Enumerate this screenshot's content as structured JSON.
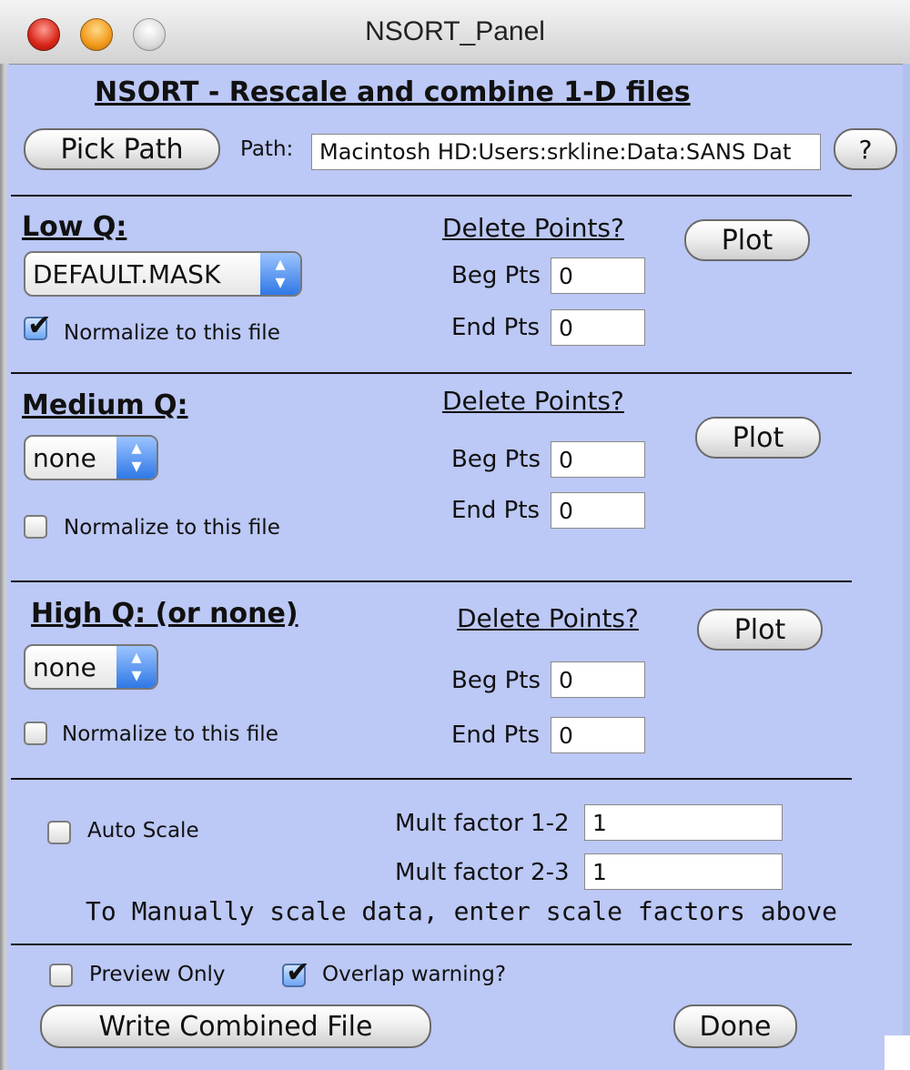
{
  "window": {
    "title": "NSORT_Panel"
  },
  "header": {
    "title": "NSORT - Rescale and combine 1-D files"
  },
  "path": {
    "button": "Pick Path",
    "label": "Path:",
    "value": "Macintosh HD:Users:srkline:Data:SANS Dat",
    "help": "?"
  },
  "low": {
    "heading": "Low Q:",
    "file": "DEFAULT.MASK",
    "normalize": "Normalize to this file",
    "normalize_checked": true,
    "delete": "Delete Points?",
    "beg_label": "Beg Pts",
    "beg_value": "0",
    "end_label": "End Pts",
    "end_value": "0",
    "plot": "Plot"
  },
  "medium": {
    "heading": "Medium Q:",
    "file": "none",
    "normalize": "Normalize to this file",
    "normalize_checked": false,
    "delete": "Delete Points?",
    "beg_label": "Beg Pts",
    "beg_value": "0",
    "end_label": "End Pts",
    "end_value": "0",
    "plot": "Plot"
  },
  "high": {
    "heading": "High Q: (or none)",
    "file": "none",
    "normalize": "Normalize to this file",
    "normalize_checked": false,
    "delete": "Delete Points?",
    "beg_label": "Beg Pts",
    "beg_value": "0",
    "end_label": "End Pts",
    "end_value": "0",
    "plot": "Plot"
  },
  "scale": {
    "auto": "Auto Scale",
    "auto_checked": false,
    "mult12_label": "Mult factor 1-2",
    "mult12_value": "1",
    "mult23_label": "Mult factor 2-3",
    "mult23_value": "1",
    "hint": "To Manually scale data, enter scale factors above"
  },
  "footer": {
    "preview": "Preview Only",
    "preview_checked": false,
    "overlap": "Overlap warning?",
    "overlap_checked": true,
    "write": "Write Combined File",
    "done": "Done"
  },
  "icons": {
    "popup_arrows": "updown-arrows-icon",
    "check": "checkmark-icon"
  },
  "colors": {
    "panel_bg": "#bcc8f5",
    "accent": "#2f78e6"
  }
}
